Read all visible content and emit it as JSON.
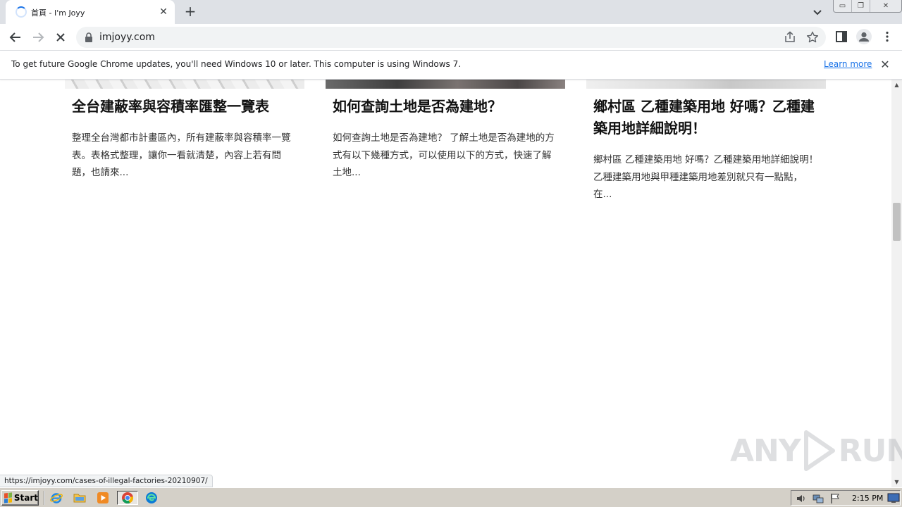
{
  "browser": {
    "tab": {
      "title": "首頁 - I'm Joyy",
      "close_glyph": "✕"
    },
    "new_tab_glyph": "+",
    "window_controls": {
      "minimize": "▭",
      "restore": "❐",
      "close": "✕"
    },
    "address": "imjoyy.com"
  },
  "infobar": {
    "message": "To get future Google Chrome updates, you'll need Windows 10 or later. This computer is using Windows 7.",
    "link": "Learn more",
    "close_glyph": "✕"
  },
  "cards": [
    {
      "title": "全台建蔽率與容積率匯整一覽表",
      "excerpt": "整理全台灣都市計畫區內，所有建蔽率與容積率一覽表。表格式整理，讓你一看就清楚，內容上若有問題，也請來..."
    },
    {
      "title": "如何查詢土地是否為建地？",
      "excerpt": "如何查詢土地是否為建地？ 了解土地是否為建地的方式有以下幾種方式，可以使用以下的方式，快速了解土地..."
    },
    {
      "title": "鄉村區 乙種建築用地 好嗎？乙種建築用地詳細說明！",
      "excerpt": "鄉村區 乙種建築用地 好嗎？乙種建築用地詳細說明！乙種建築用地與甲種建築用地差別就只有一點點，在..."
    }
  ],
  "status_url": "https://imjoyy.com/cases-of-illegal-factories-20210907/",
  "watermark": {
    "left": "ANY",
    "right": "RUN"
  },
  "scrollbar": {
    "up": "▲",
    "down": "▼"
  },
  "taskbar": {
    "start_label": "Start",
    "apps": [
      "ie-icon",
      "explorer-icon",
      "media-player-icon",
      "chrome-icon",
      "edge-icon"
    ],
    "clock": "2:15 PM"
  },
  "colors": {
    "accent": "#1a73e8",
    "tabstrip": "#dee1e6",
    "taskbar": "#d4d0c8"
  }
}
